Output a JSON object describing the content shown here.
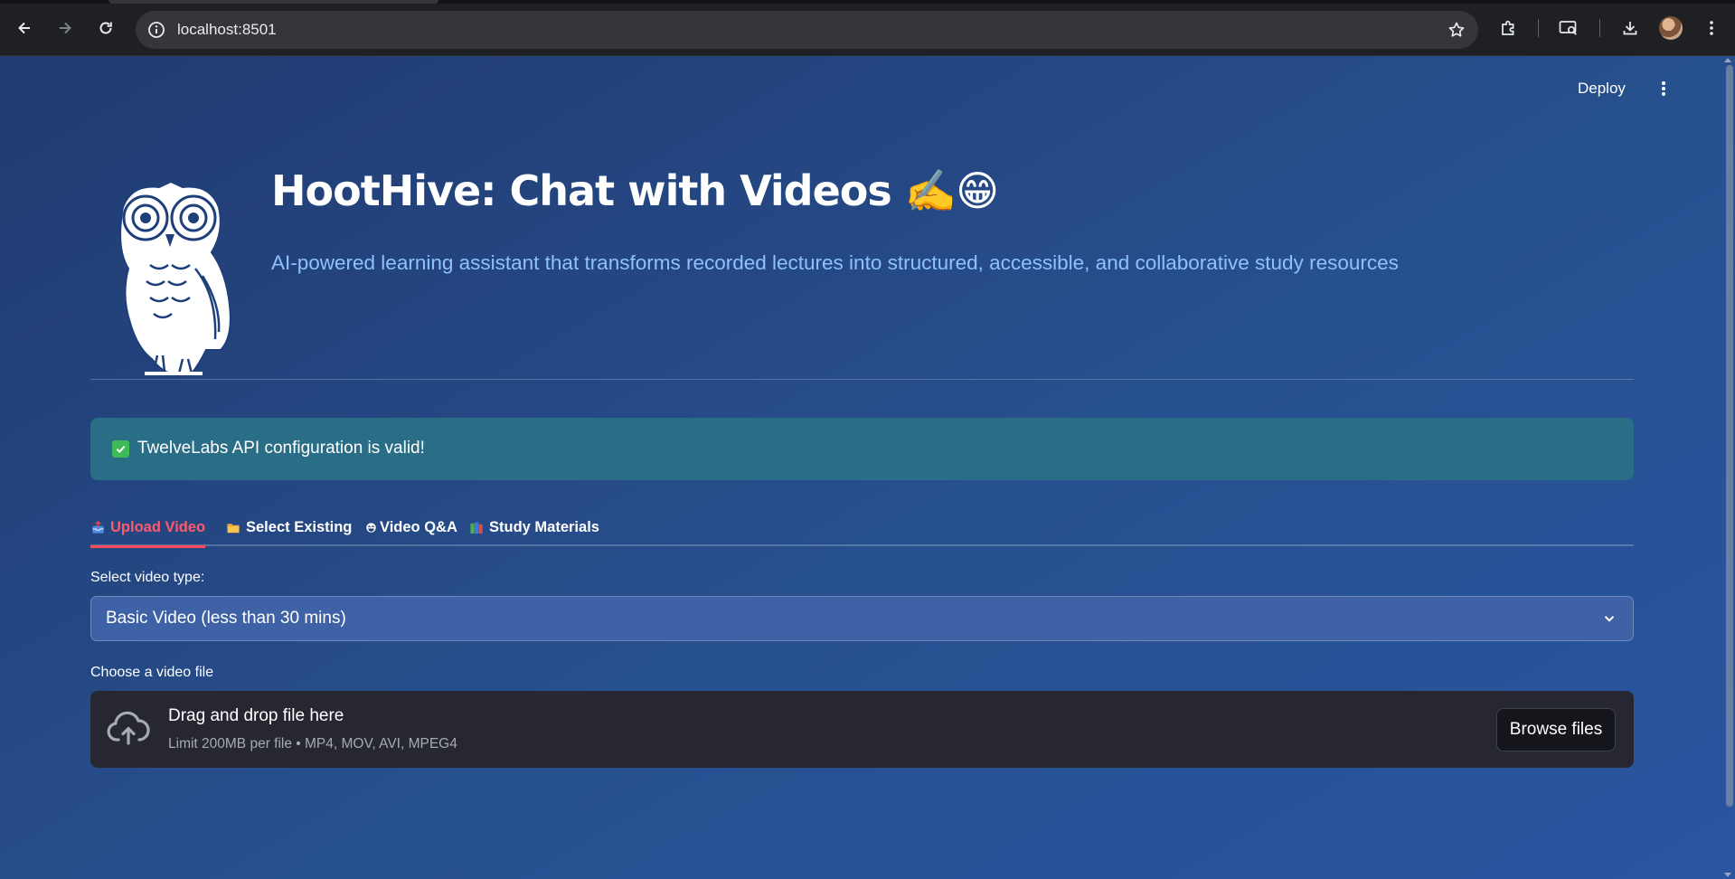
{
  "browser": {
    "url": "localhost:8501"
  },
  "toolbar": {
    "deploy_label": "Deploy"
  },
  "header": {
    "title": "HootHive: Chat with Videos ✍️😁",
    "subtitle": "AI-powered learning assistant that transforms recorded lectures into structured, accessible, and collaborative study resources"
  },
  "alert": {
    "icon": "✅",
    "text": "TwelveLabs API configuration is valid!"
  },
  "tabs": [
    {
      "icon": "📤",
      "label": "Upload Video",
      "active": true
    },
    {
      "icon": "📁",
      "label": "Select Existing",
      "active": false
    },
    {
      "icon": "😁",
      "label": "Video Q&A",
      "active": false
    },
    {
      "icon": "📚",
      "label": "Study Materials",
      "active": false
    }
  ],
  "video_type": {
    "label": "Select video type:",
    "selected": "Basic Video (less than 30 mins)"
  },
  "uploader": {
    "label": "Choose a video file",
    "title": "Drag and drop file here",
    "limit": "Limit 200MB per file • MP4, MOV, AVI, MPEG4",
    "button": "Browse files"
  },
  "colors": {
    "accent_red": "#ff4b5c",
    "success_bg": "#2a6d86",
    "page_bg": "#27508f"
  }
}
